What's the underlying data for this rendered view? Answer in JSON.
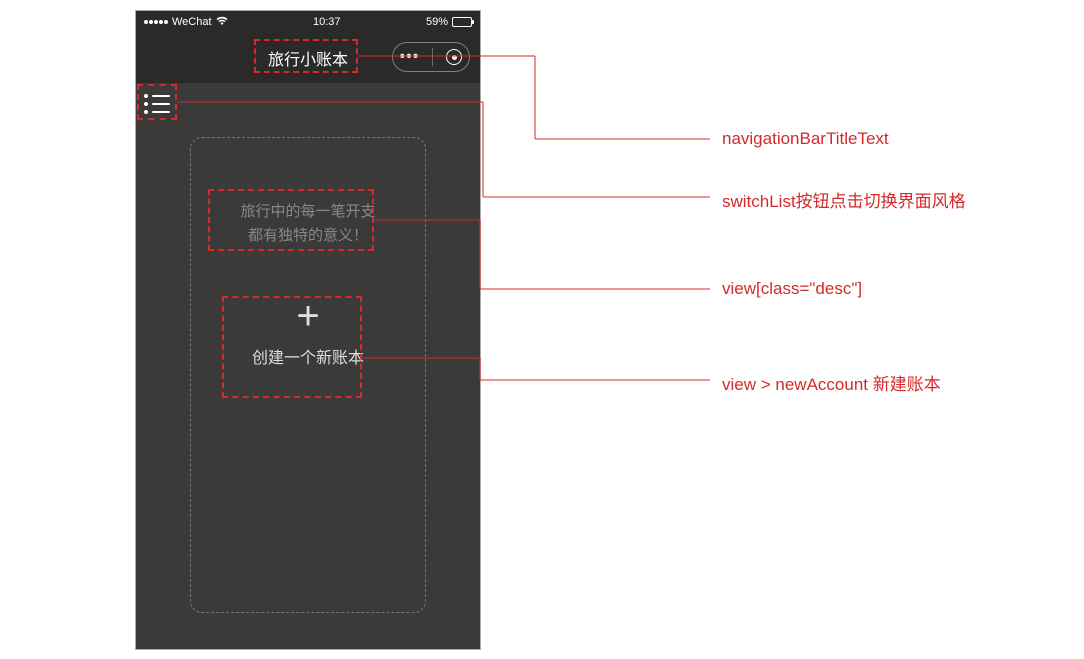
{
  "statusbar": {
    "carrier": "WeChat",
    "time": "10:37",
    "battery_pct": "59%"
  },
  "navbar": {
    "title": "旅行小账本"
  },
  "desc": {
    "line1": "旅行中的每一笔开支",
    "line2": "都有独特的意义！"
  },
  "newAccount": {
    "plus": "+",
    "label": "创建一个新账本"
  },
  "annotations": {
    "title": "navigationBarTitleText",
    "switchList": "switchList按钮点击切换界面风格",
    "desc": "view[class=\"desc\"]",
    "newAccount": "view > newAccount 新建账本"
  }
}
